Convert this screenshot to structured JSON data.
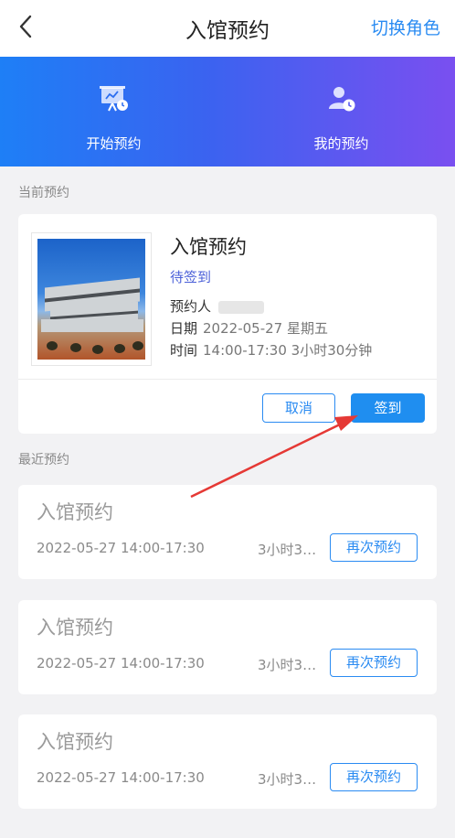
{
  "header": {
    "title": "入馆预约",
    "switch_role": "切换角色",
    "back_icon": "chevron-left-icon"
  },
  "banner": {
    "items": [
      {
        "label": "开始预约",
        "icon": "presentation-clock-icon"
      },
      {
        "label": "我的预约",
        "icon": "person-clock-icon"
      }
    ],
    "colors": {
      "start": "#1e7ff6",
      "end": "#7a4ff0"
    }
  },
  "current": {
    "section_label": "当前预约",
    "title": "入馆预约",
    "status": "待签到",
    "person_label": "预约人",
    "date_label": "日期",
    "date_value": "2022-05-27 星期五",
    "time_label": "时间",
    "time_value": "14:00-17:30 3小时30分钟",
    "cancel_label": "取消",
    "checkin_label": "签到"
  },
  "recent": {
    "section_label": "最近预约",
    "items": [
      {
        "title": "入馆预约",
        "time": "2022-05-27 14:00-17:30",
        "duration": "3小时3…",
        "rebook": "再次预约"
      },
      {
        "title": "入馆预约",
        "time": "2022-05-27 14:00-17:30",
        "duration": "3小时3…",
        "rebook": "再次预约"
      },
      {
        "title": "入馆预约",
        "time": "2022-05-27 14:00-17:30",
        "duration": "3小时3…",
        "rebook": "再次预约"
      }
    ]
  },
  "colors": {
    "accent": "#2a8bf2",
    "status": "#4a5fd8",
    "annotation_arrow": "#e53935"
  }
}
